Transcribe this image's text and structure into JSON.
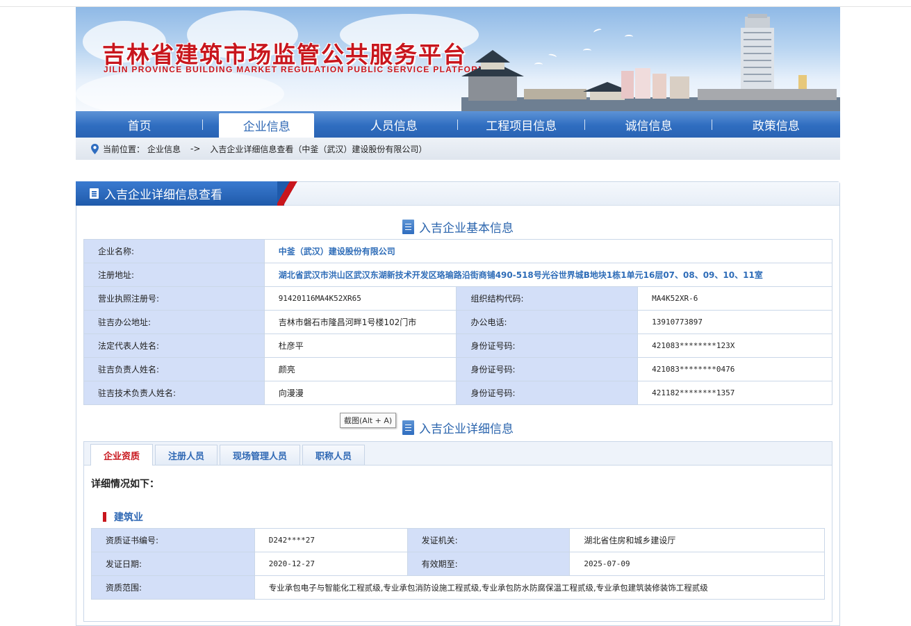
{
  "banner": {
    "title": "吉林省建筑市场监管公共服务平台",
    "subtitle": "JILIN PROVINCE BUILDING MARKET REGULATION PUBLIC SERVICE PLATFORMS"
  },
  "nav": {
    "items": [
      {
        "label": "首页"
      },
      {
        "label": "企业信息",
        "active": true
      },
      {
        "label": "人员信息"
      },
      {
        "label": "工程项目信息"
      },
      {
        "label": "诚信信息"
      },
      {
        "label": "政策信息"
      }
    ]
  },
  "breadcrumb": {
    "prefix": "当前位置：",
    "level1": "企业信息",
    "arrow": "->",
    "level2": "入吉企业详细信息查看（中釜（武汉）建设股份有限公司）"
  },
  "panel": {
    "title": "入吉企业详细信息查看"
  },
  "basic": {
    "title": "入吉企业基本信息",
    "company_name_label": "企业名称:",
    "company_name": "中釜（武汉）建设股份有限公司",
    "address_label": "注册地址:",
    "address": "湖北省武汉市洪山区武汉东湖新技术开发区珞瑜路沿街商铺490-518号光谷世界城B地块1栋1单元16层07、08、09、10、11室",
    "license_label": "营业执照注册号:",
    "license": "91420116MA4K52XR65",
    "org_code_label": "组织结构代码:",
    "org_code": "MA4K52XR-6",
    "office_label": "驻吉办公地址:",
    "office": "吉林市磐石市隆昌河畔1号楼102门市",
    "phone_label": "办公电话:",
    "phone": "13910773897",
    "legal_label": "法定代表人姓名:",
    "legal": "杜彦平",
    "legal_id_label": "身份证号码:",
    "legal_id": "421083********123X",
    "manager_label": "驻吉负责人姓名:",
    "manager": "颜亮",
    "manager_id_label": "身份证号码:",
    "manager_id": "421083********0476",
    "tech_label": "驻吉技术负责人姓名:",
    "tech": "向漫漫",
    "tech_id_label": "身份证号码:",
    "tech_id": "421182********1357"
  },
  "tooltip": "截图(Alt + A)",
  "detail": {
    "title": "入吉企业详细信息",
    "tabs": [
      {
        "label": "企业资质",
        "active": true
      },
      {
        "label": "注册人员"
      },
      {
        "label": "现场管理人员"
      },
      {
        "label": "职称人员"
      }
    ],
    "heading": "详细情况如下：",
    "category": "建筑业",
    "cert_no_label": "资质证书编号:",
    "cert_no": "D242****27",
    "issuer_label": "发证机关:",
    "issuer": "湖北省住房和城乡建设厅",
    "issue_date_label": "发证日期:",
    "issue_date": "2020-12-27",
    "valid_label": "有效期至:",
    "valid": "2025-07-09",
    "scope_label": "资质范围:",
    "scope": "专业承包电子与智能化工程贰级,专业承包消防设施工程贰级,专业承包防水防腐保温工程贰级,专业承包建筑装修装饰工程贰级"
  },
  "colors": {
    "brand_red": "#c8161d",
    "nav_blue": "#2f6dc0",
    "label_bg": "#d3dff8",
    "link_blue": "#2f6db8"
  }
}
